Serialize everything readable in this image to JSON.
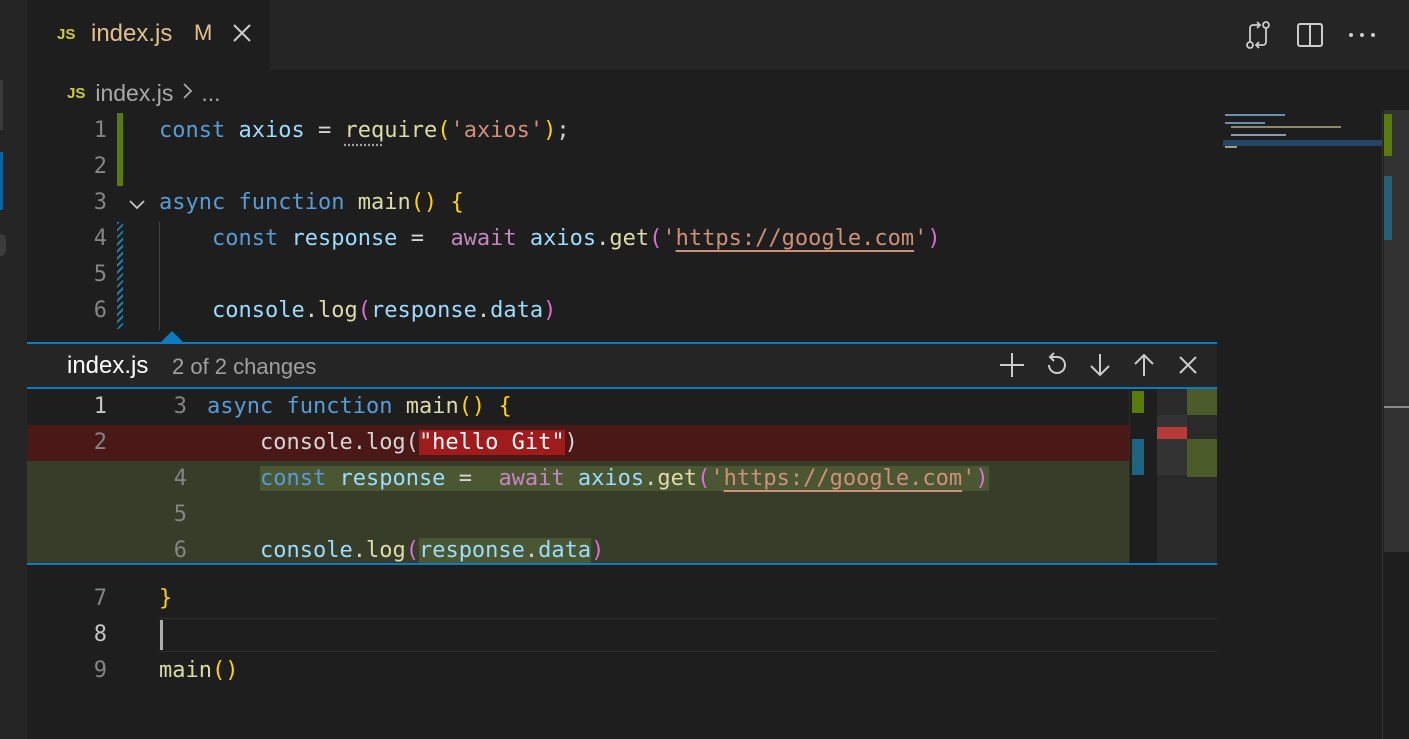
{
  "tab": {
    "icon": "JS",
    "title": "index.js",
    "status": "M"
  },
  "title_actions": [
    "open-changes-icon",
    "split-editor-icon",
    "more-actions-icon"
  ],
  "breadcrumb": {
    "icon": "JS",
    "file": "index.js",
    "more": "..."
  },
  "peek": {
    "file": "index.js",
    "description": "2 of 2 changes",
    "actions": [
      "stage-change-icon",
      "revert-change-icon",
      "next-change-icon",
      "previous-change-icon",
      "close-icon"
    ]
  },
  "diff": {
    "line1": {
      "orig": "1",
      "mod": "3"
    },
    "line2": {
      "orig": "2"
    },
    "line4": {
      "mod": "4"
    },
    "line5": {
      "mod": "5"
    },
    "line6": {
      "mod": "6"
    }
  },
  "code": {
    "line_numbers": [
      "1",
      "2",
      "3",
      "4",
      "5",
      "6",
      "7",
      "8",
      "9"
    ]
  },
  "colors": {
    "keyword": "#569cd6",
    "variable": "#9cdcfe",
    "function": "#dcdcaa",
    "string": "#ce9178",
    "control": "#c586c0",
    "added": "#587c0c",
    "modified": "#1b81a8",
    "removed": "#a01b1b",
    "accent": "#0e7ac0"
  }
}
